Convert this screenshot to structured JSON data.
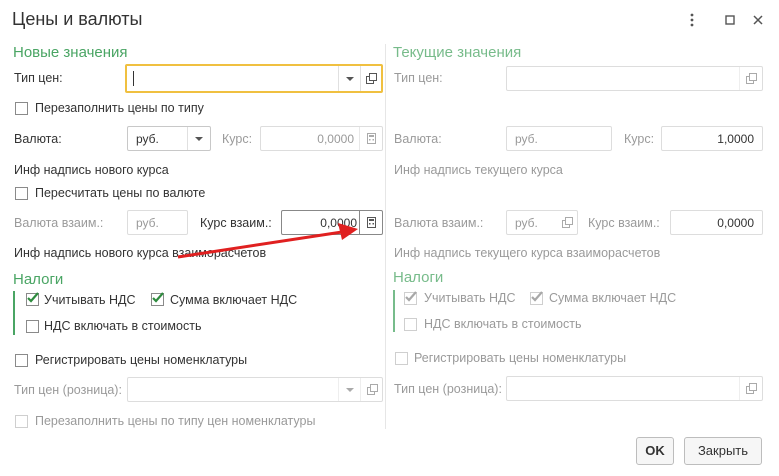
{
  "window": {
    "title": "Цены и валюты"
  },
  "icons": {
    "menu": "more-vertical-icon",
    "maximize": "maximize-icon",
    "close": "close-icon",
    "open": "open-external-icon",
    "dropdown": "chevron-down-icon",
    "calculator": "calculator-icon",
    "check": "checkmark-icon"
  },
  "colors": {
    "section": "#4aa564",
    "focus": "#f0c040",
    "arrow": "#e02020"
  },
  "left": {
    "heading": "Новые значения",
    "price_type_label": "Тип цен:",
    "price_type_value": "",
    "refill_by_type_label": "Перезаполнить цены по типу",
    "currency_label": "Валюта:",
    "currency_value": "руб.",
    "rate_label": "Курс:",
    "rate_value": "0,0000",
    "new_rate_info": "Инф надпись нового курса",
    "recalc_label": "Пересчитать цены по валюте",
    "settle_currency_label": "Валюта взаим.:",
    "settle_currency_value": "руб.",
    "settle_rate_label": "Курс взаим.:",
    "settle_rate_value": "0,0000",
    "new_settle_info": "Инф надпись нового курса взаиморасчетов",
    "taxes_heading": "Налоги",
    "vat_label": "Учитывать НДС",
    "sum_incl_vat_label": "Сумма включает НДС",
    "vat_in_cost_label": "НДС включать в стоимость",
    "register_prices_label": "Регистрировать цены номенклатуры",
    "retail_type_label": "Тип цен (розница):",
    "refill_nomenclature_label": "Перезаполнить цены по типу цен номенклатуры"
  },
  "right": {
    "heading": "Текущие значения",
    "price_type_label": "Тип цен:",
    "currency_label": "Валюта:",
    "currency_value": "руб.",
    "rate_label": "Курс:",
    "rate_value": "1,0000",
    "current_rate_info": "Инф надпись текущего курса",
    "settle_currency_label": "Валюта взаим.:",
    "settle_currency_value": "руб.",
    "settle_rate_label": "Курс взаим.:",
    "settle_rate_value": "0,0000",
    "current_settle_info": "Инф надпись текущего курса взаиморасчетов",
    "taxes_heading": "Налоги",
    "vat_label": "Учитывать НДС",
    "sum_incl_vat_label": "Сумма включает НДС",
    "vat_in_cost_label": "НДС включать в стоимость",
    "register_prices_label": "Регистрировать цены номенклатуры",
    "retail_type_label": "Тип цен (розница):"
  },
  "footer": {
    "ok_label": "OK",
    "close_label": "Закрыть"
  }
}
